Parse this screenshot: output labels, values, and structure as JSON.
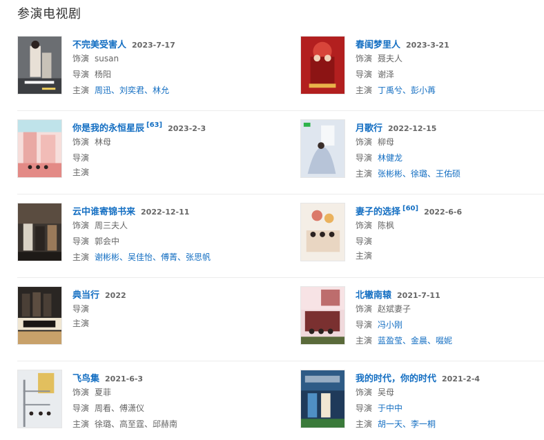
{
  "section_title": "参演电视剧",
  "labels": {
    "role": "饰演",
    "director": "导演",
    "cast": "主演"
  },
  "dramas": [
    {
      "title": "不完美受害人",
      "badge": "",
      "date": "2023-7-17",
      "role": "susan",
      "director": "杨阳",
      "director_link": false,
      "cast": "周迅、刘奕君、林允",
      "poster": {
        "bg": "#6b6e72",
        "accent": "#c8c2b8"
      }
    },
    {
      "title": "春闺梦里人",
      "badge": "",
      "date": "2023-3-21",
      "role": "聂夫人",
      "director": "谢泽",
      "director_link": false,
      "cast": "丁禹兮、彭小苒",
      "poster": {
        "bg": "#b21f1f",
        "accent": "#e8b34a"
      }
    },
    {
      "title": "你是我的永恒星辰",
      "badge": "[63]",
      "date": "2023-2-3",
      "role": "林母",
      "director": "",
      "director_link": false,
      "cast": "",
      "poster": {
        "bg": "#f2c9c4",
        "accent": "#e38a86"
      }
    },
    {
      "title": "月歌行",
      "badge": "",
      "date": "2022-12-15",
      "role": "柳母",
      "director": "林健龙",
      "director_link": true,
      "cast": "张彬彬、徐璐、王佑硕",
      "poster": {
        "bg": "#dfe6ef",
        "accent": "#8da0bd"
      }
    },
    {
      "title": "云中谁寄锦书来",
      "badge": "",
      "date": "2022-12-11",
      "role": "周三夫人",
      "director": "郭会中",
      "director_link": false,
      "cast": "谢彬彬、吴佳怡、傅菁、张思帆",
      "poster": {
        "bg": "#3b3530",
        "accent": "#9a7a5a"
      }
    },
    {
      "title": "妻子的选择",
      "badge": "[60]",
      "date": "2022-6-6",
      "role": "陈枫",
      "director": "",
      "director_link": false,
      "cast": "",
      "poster": {
        "bg": "#f4eee6",
        "accent": "#d45b4a"
      }
    },
    {
      "title": "典当行",
      "badge": "",
      "date": "2022",
      "role": "",
      "director": "",
      "director_link": false,
      "cast": "",
      "poster": {
        "bg": "#2a2623",
        "accent": "#c8a16a"
      }
    },
    {
      "title": "北辙南辕",
      "badge": "",
      "date": "2021-7-11",
      "role": "赵斌妻子",
      "director": "冯小刚",
      "director_link": true,
      "cast": "蓝盈莹、金晨、啜妮",
      "poster": {
        "bg": "#f0d9dc",
        "accent": "#a43a3a"
      }
    },
    {
      "title": "飞鸟集",
      "badge": "",
      "date": "2021-6-3",
      "role": "夏菲",
      "director": "周看、傅潇仪",
      "director_link": false,
      "cast": "徐璐、高至霆、邱赫南",
      "poster": {
        "bg": "#e9ecef",
        "accent": "#e0b43a"
      }
    },
    {
      "title": "我的时代，你的时代",
      "badge": "",
      "date": "2021-2-4",
      "role": "吴母",
      "director": "于中中",
      "director_link": true,
      "cast": "胡一天、李一桐",
      "poster": {
        "bg": "#1f3a5a",
        "accent": "#4f8fc4"
      }
    }
  ]
}
